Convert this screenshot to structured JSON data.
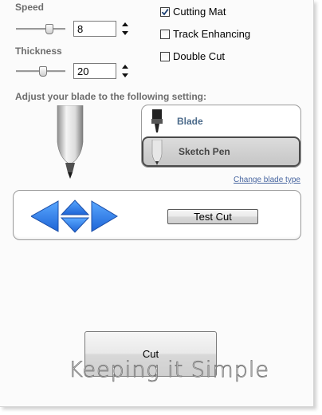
{
  "speed": {
    "label": "Speed",
    "value": "8",
    "slider_fraction": 0.72
  },
  "thickness": {
    "label": "Thickness",
    "value": "20",
    "slider_fraction": 0.55
  },
  "options": [
    {
      "label": "Cutting Mat",
      "checked": true
    },
    {
      "label": "Track Enhancing",
      "checked": false
    },
    {
      "label": "Double Cut",
      "checked": false
    }
  ],
  "blade_heading": "Adjust your blade to the following setting:",
  "blades": [
    {
      "label": "Blade",
      "selected": false,
      "icon": "blade-icon"
    },
    {
      "label": "Sketch Pen",
      "selected": true,
      "icon": "sketch-pen-icon"
    }
  ],
  "change_blade_link": "Change blade type",
  "test_cut_label": "Test Cut",
  "cut_label": "Cut",
  "watermark": "Keeping it Simple",
  "colors": {
    "arrow_blue": "#2f7fe6",
    "link_blue": "#4866a0",
    "label_gray": "#6d6d6d"
  }
}
